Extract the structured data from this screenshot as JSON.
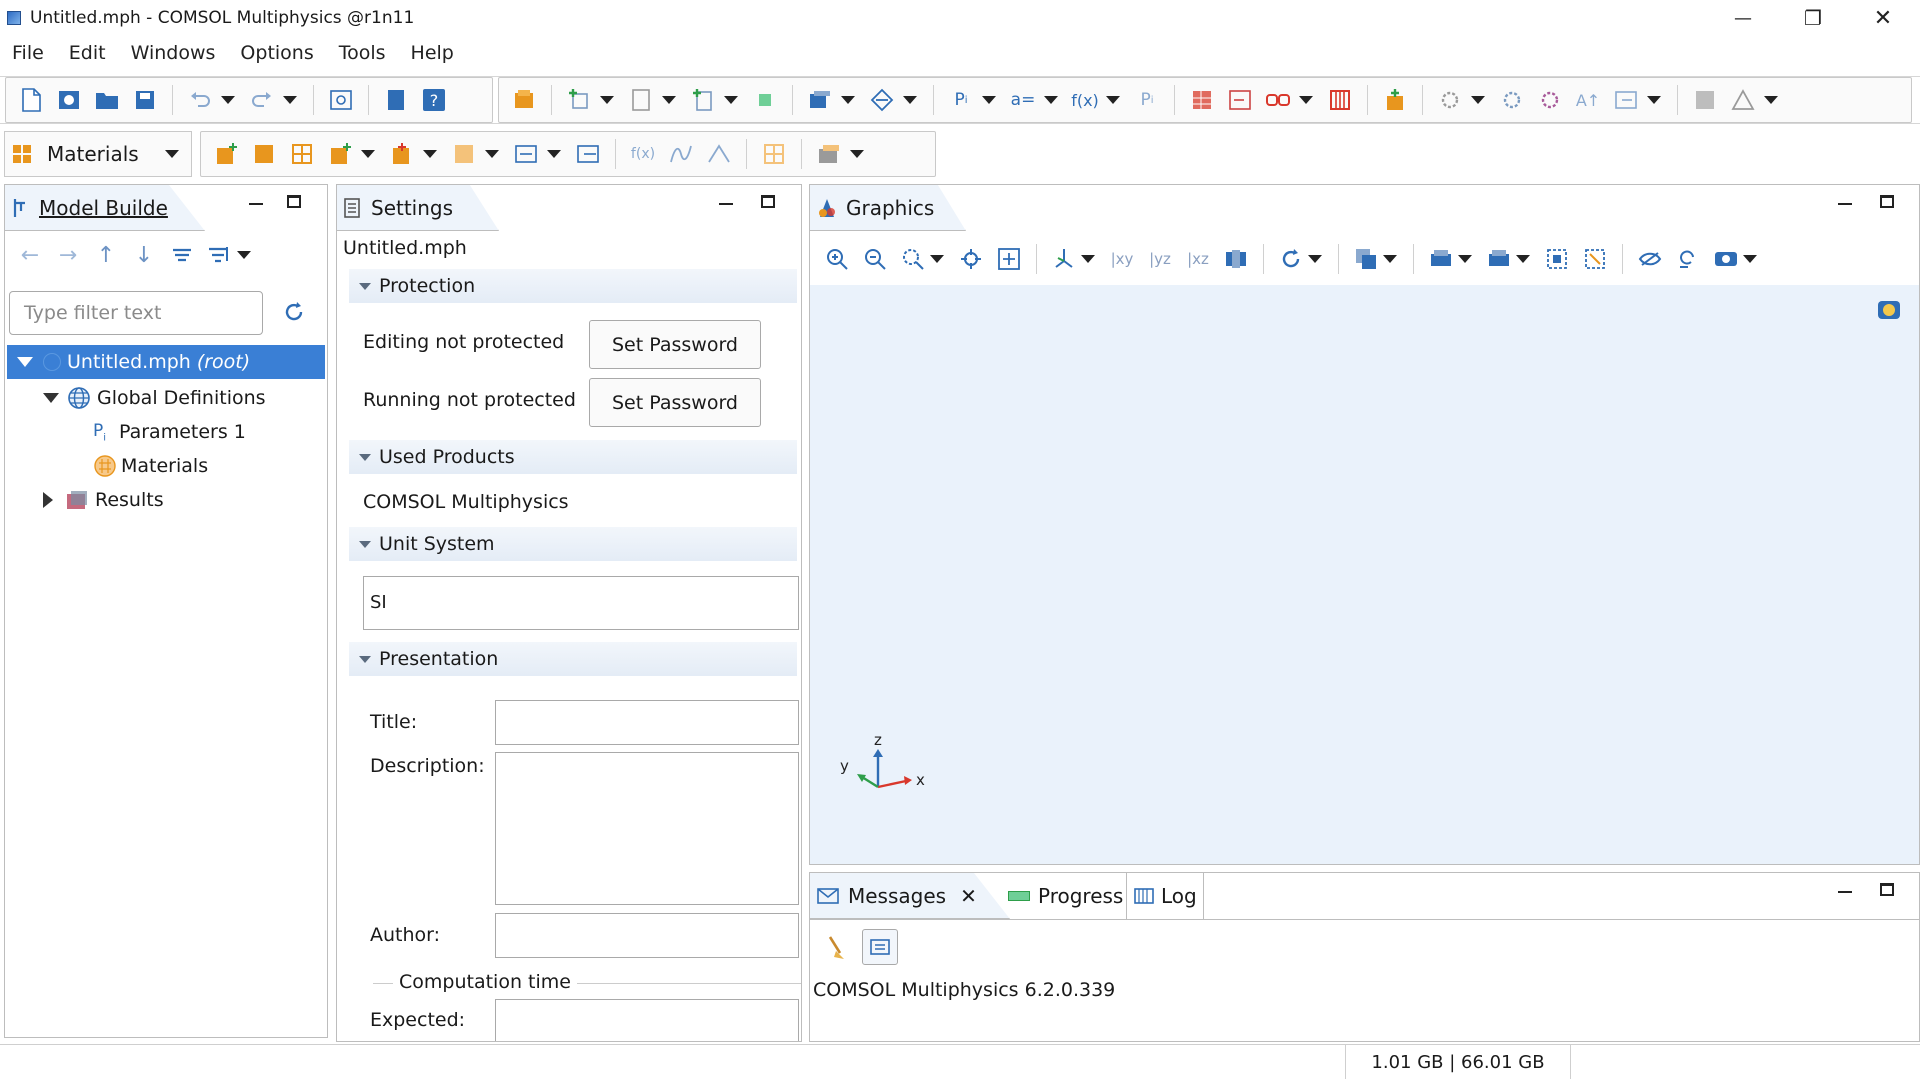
{
  "window": {
    "title": "Untitled.mph - COMSOL Multiphysics @r1n11",
    "minimize_glyph": "—",
    "restore_glyph": "❐",
    "close_glyph": "✕"
  },
  "menu": [
    "File",
    "Edit",
    "Windows",
    "Options",
    "Tools",
    "Help"
  ],
  "ribbon": {
    "selector_label": "Materials"
  },
  "model_builder": {
    "tab_label": "Model Builde",
    "filter_placeholder": "Type filter text",
    "tree": {
      "root_name": "Untitled.mph",
      "root_suffix": "(root)",
      "global_definitions": "Global Definitions",
      "parameters": "Parameters 1",
      "materials": "Materials",
      "results": "Results"
    }
  },
  "settings": {
    "tab_label": "Settings",
    "file_name": "Untitled.mph",
    "protection": {
      "header": "Protection",
      "editing_label": "Editing not protected",
      "running_label": "Running not protected",
      "set_password_1": "Set Password",
      "set_password_2": "Set Password"
    },
    "used_products": {
      "header": "Used Products",
      "product": "COMSOL Multiphysics"
    },
    "unit_system": {
      "header": "Unit System",
      "value": "SI"
    },
    "presentation": {
      "header": "Presentation",
      "title_label": "Title:",
      "title_value": "",
      "description_label": "Description:",
      "description_value": "",
      "author_label": "Author:",
      "author_value": "",
      "computation_time": "Computation time",
      "expected_label": "Expected:",
      "expected_value": ""
    }
  },
  "graphics": {
    "tab_label": "Graphics",
    "axis_labels": {
      "z": "z",
      "y": "y",
      "x": "x"
    }
  },
  "messages": {
    "tab_messages": "Messages",
    "tab_progress": "Progress",
    "tab_log": "Log",
    "text": "COMSOL Multiphysics 6.2.0.339"
  },
  "status": {
    "memory": "1.01 GB | 66.01 GB"
  },
  "colors": {
    "selection": "#3a7fd5",
    "graphics_bg": "#eaf2fb",
    "tab_bg": "#eef4fb",
    "icon_blue": "#2f6db5",
    "icon_orange": "#e8961e",
    "icon_red": "#d9382c"
  }
}
